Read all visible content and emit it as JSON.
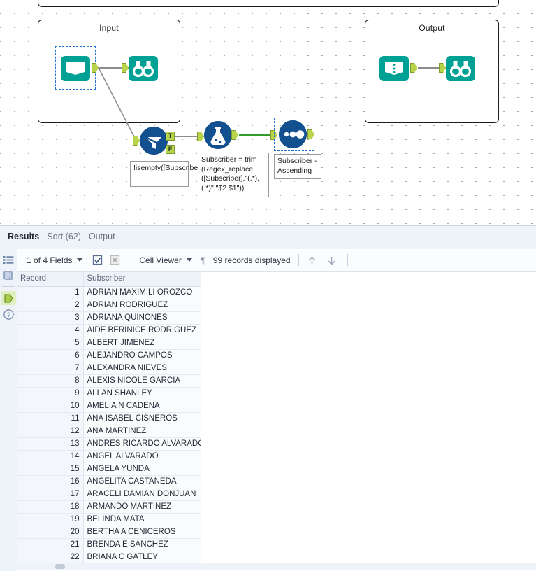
{
  "canvas": {
    "containers": [
      {
        "id": "top-partial",
        "title": ""
      },
      {
        "id": "input-container",
        "title": "Input"
      },
      {
        "id": "output-container",
        "title": "Output"
      }
    ],
    "tools": {
      "input_data": "input-data-tool",
      "input_browse": "browse-tool",
      "filter": "filter-tool",
      "formula": "formula-tool",
      "sort": "sort-tool",
      "output_data": "output-data-tool",
      "output_browse": "browse-tool"
    },
    "plug_labels": {
      "true": "T",
      "false": "F"
    },
    "annotations": {
      "filter": "!isempty([Subscriber])",
      "formula": "Subscriber = trim (Regex_replace ([Subscriber],\"(.*), (.*)\",\"$2 $1\"))",
      "sort": "Subscriber - Ascending"
    }
  },
  "results": {
    "header": {
      "title": "Results",
      "subtitle": "- Sort (62) - Output"
    },
    "rail": {
      "items": [
        {
          "name": "list-view-icon"
        },
        {
          "name": "column-view-icon"
        },
        {
          "name": "output-anchor-icon"
        },
        {
          "name": "help-icon"
        }
      ]
    },
    "toolbar": {
      "fields_label": "1 of 4 Fields",
      "select_all_icon": "checkbox-checked-icon",
      "deselect_icon": "checkbox-disabled-icon",
      "viewer_label": "Cell Viewer",
      "pilcrow_icon": "pilcrow-icon",
      "records_label": "99 records displayed",
      "up_icon": "arrow-up-icon",
      "down_icon": "arrow-down-icon"
    },
    "grid": {
      "columns": [
        "Record",
        "Subscriber"
      ],
      "rows": [
        [
          "1",
          "ADRIAN MAXIMILI OROZCO"
        ],
        [
          "2",
          "ADRIAN RODRIGUEZ"
        ],
        [
          "3",
          "ADRIANA QUINONES"
        ],
        [
          "4",
          "AIDE BERINICE RODRIGUEZ"
        ],
        [
          "5",
          "ALBERT JIMENEZ"
        ],
        [
          "6",
          "ALEJANDRO CAMPOS"
        ],
        [
          "7",
          "ALEXANDRA NIEVES"
        ],
        [
          "8",
          "ALEXIS NICOLE GARCIA"
        ],
        [
          "9",
          "ALLAN SHANLEY"
        ],
        [
          "10",
          "AMELIA N CADENA"
        ],
        [
          "11",
          "ANA ISABEL CISNEROS"
        ],
        [
          "12",
          "ANA MARTINEZ"
        ],
        [
          "13",
          "ANDRES RICARDO ALVARADO"
        ],
        [
          "14",
          "ANGEL ALVARADO"
        ],
        [
          "15",
          "ANGELA YUNDA"
        ],
        [
          "16",
          "ANGELITA CASTANEDA"
        ],
        [
          "17",
          "ARACELI DAMIAN DONJUAN"
        ],
        [
          "18",
          "ARMANDO MARTINEZ"
        ],
        [
          "19",
          "BELINDA MATA"
        ],
        [
          "20",
          "BERTHA A CENICEROS"
        ],
        [
          "21",
          "BRENDA E SANCHEZ"
        ],
        [
          "22",
          "BRIANA C GATLEY"
        ]
      ]
    }
  },
  "colors": {
    "teal": "#00a195",
    "blue": "#12508f",
    "plug_green": "#b7d44a",
    "wire_green": "#2f9e2f",
    "selection_blue": "#1f6fd0",
    "pane_bg": "#eef2f9"
  }
}
